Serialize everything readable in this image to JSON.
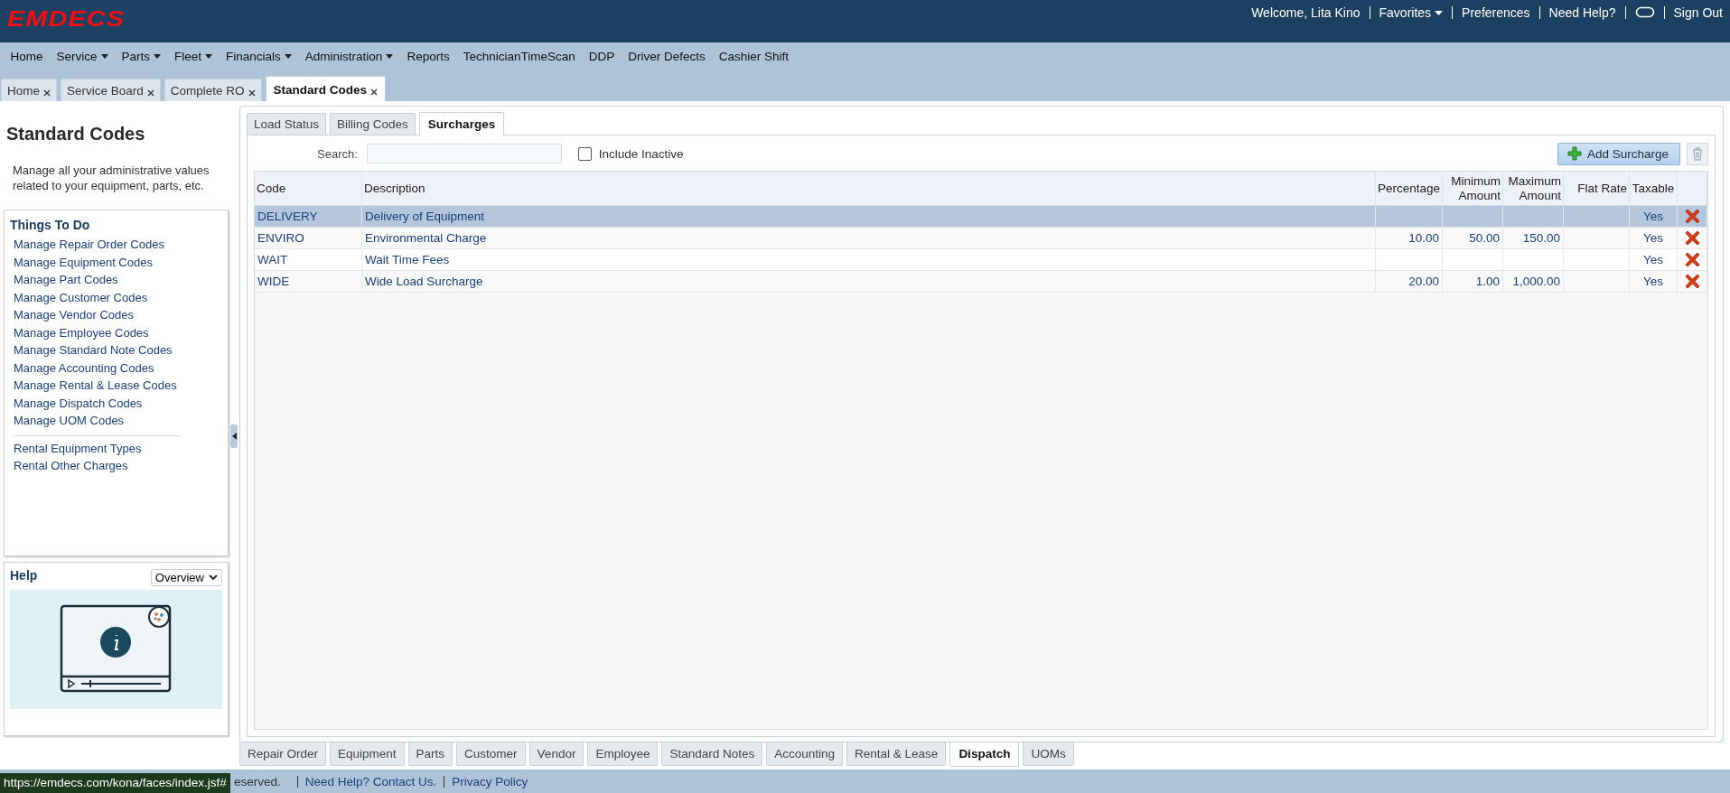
{
  "header": {
    "logo": "EMDECS",
    "welcome": "Welcome, Lita Kino",
    "favorites": "Favorites",
    "preferences": "Preferences",
    "need_help": "Need Help?",
    "sign_out": "Sign Out"
  },
  "nav": [
    {
      "label": "Home",
      "dropdown": false
    },
    {
      "label": "Service",
      "dropdown": true
    },
    {
      "label": "Parts",
      "dropdown": true
    },
    {
      "label": "Fleet",
      "dropdown": true
    },
    {
      "label": "Financials",
      "dropdown": true
    },
    {
      "label": "Administration",
      "dropdown": true
    },
    {
      "label": "Reports",
      "dropdown": false
    },
    {
      "label": "TechnicianTimeScan",
      "dropdown": false
    },
    {
      "label": "DDP",
      "dropdown": false
    },
    {
      "label": "Driver Defects",
      "dropdown": false
    },
    {
      "label": "Cashier Shift",
      "dropdown": false
    }
  ],
  "doc_tabs": [
    {
      "label": "Home",
      "selected": false
    },
    {
      "label": "Service Board",
      "selected": false
    },
    {
      "label": "Complete RO",
      "selected": false
    },
    {
      "label": "Standard Codes",
      "selected": true
    }
  ],
  "sidebar": {
    "title": "Standard Codes",
    "description": "Manage all your administrative values related to your equipment, parts, etc.",
    "things_to_do": {
      "title": "Things To Do",
      "items": [
        "Manage Repair Order Codes",
        "Manage Equipment Codes",
        "Manage Part Codes",
        "Manage Customer Codes",
        "Manage Vendor Codes",
        "Manage Employee Codes",
        "Manage Standard Note Codes",
        "Manage Accounting Codes",
        "Manage Rental & Lease Codes",
        "Manage Dispatch Codes",
        "Manage UOM Codes"
      ],
      "more_items": [
        "Rental Equipment Types",
        "Rental Other Charges"
      ]
    },
    "help": {
      "title": "Help",
      "topic": "Overview"
    }
  },
  "inner_tabs": [
    {
      "label": "Load Status",
      "selected": false
    },
    {
      "label": "Billing Codes",
      "selected": false
    },
    {
      "label": "Surcharges",
      "selected": true
    }
  ],
  "search": {
    "label": "Search:"
  },
  "include_inactive": {
    "label": "Include Inactive",
    "checked": false
  },
  "add_button": "Add Surcharge",
  "table": {
    "columns": [
      "Code",
      "Description",
      "Percentage",
      "Minimum Amount",
      "Maximum Amount",
      "Flat Rate",
      "Taxable"
    ],
    "rows": [
      {
        "code": "DELIVERY",
        "description": "Delivery of Equipment",
        "percentage": "",
        "minimum": "",
        "maximum": "",
        "flat_rate": "",
        "taxable": "Yes",
        "selected": true
      },
      {
        "code": "ENVIRO",
        "description": "Environmental Charge",
        "percentage": "10.00",
        "minimum": "50.00",
        "maximum": "150.00",
        "flat_rate": "",
        "taxable": "Yes",
        "selected": false
      },
      {
        "code": "WAIT",
        "description": "Wait Time Fees",
        "percentage": "",
        "minimum": "",
        "maximum": "",
        "flat_rate": "",
        "taxable": "Yes",
        "selected": false
      },
      {
        "code": "WIDE",
        "description": "Wide Load Surcharge",
        "percentage": "20.00",
        "minimum": "1.00",
        "maximum": "1,000.00",
        "flat_rate": "",
        "taxable": "Yes",
        "selected": false
      }
    ]
  },
  "bottom_tabs": [
    {
      "label": "Repair Order",
      "selected": false
    },
    {
      "label": "Equipment",
      "selected": false
    },
    {
      "label": "Parts",
      "selected": false
    },
    {
      "label": "Customer",
      "selected": false
    },
    {
      "label": "Vendor",
      "selected": false
    },
    {
      "label": "Employee",
      "selected": false
    },
    {
      "label": "Standard Notes",
      "selected": false
    },
    {
      "label": "Accounting",
      "selected": false
    },
    {
      "label": "Rental & Lease",
      "selected": false
    },
    {
      "label": "Dispatch",
      "selected": true
    },
    {
      "label": "UOMs",
      "selected": false
    }
  ],
  "footer": {
    "status_url": "https://emdecs.com/kona/faces/index.jsf#",
    "copyright_fragment": "eserved.",
    "links": [
      "Need Help? Contact Us.",
      "Privacy Policy"
    ]
  }
}
